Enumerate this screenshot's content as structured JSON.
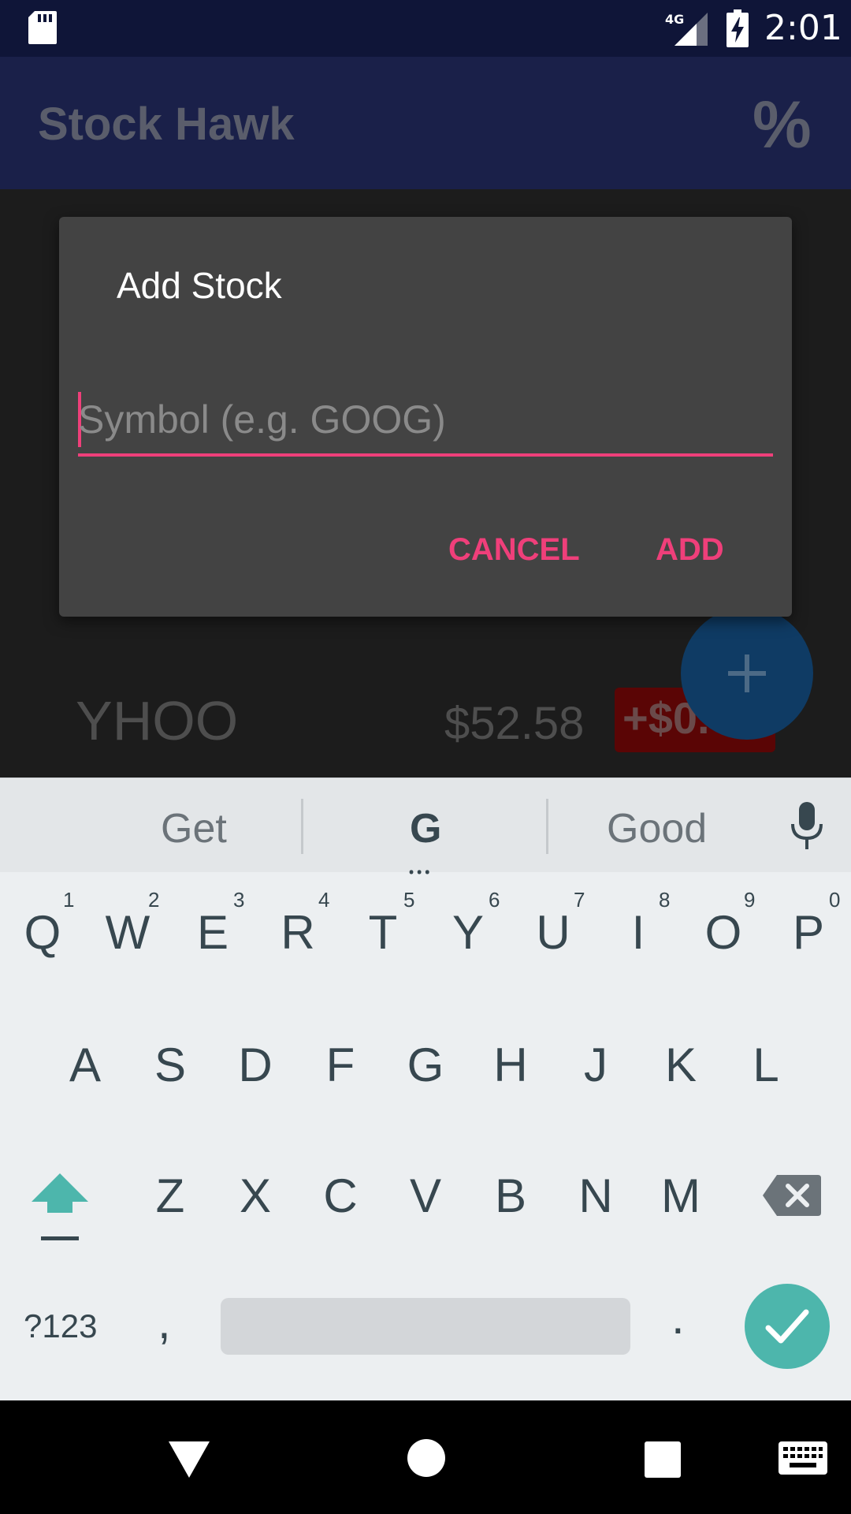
{
  "status_bar": {
    "time": "2:01",
    "network": "4G",
    "icons": [
      "sd-card-icon",
      "signal-icon",
      "battery-charging-icon"
    ]
  },
  "app_bar": {
    "title": "Stock Hawk",
    "action_label": "%"
  },
  "stock_list": [
    {
      "symbol": "YHOO",
      "price": "$52.58",
      "change": "+$0.",
      "change_color": "#5a0505"
    }
  ],
  "fab": {
    "icon": "plus-icon"
  },
  "dialog": {
    "title": "Add Stock",
    "input_placeholder": "Symbol (e.g. GOOG)",
    "input_value": "",
    "cancel_label": "CANCEL",
    "add_label": "ADD",
    "accent_color": "#ef3f7a"
  },
  "keyboard": {
    "suggestions": [
      "Get",
      "G",
      "Good"
    ],
    "row1": [
      "Q",
      "W",
      "E",
      "R",
      "T",
      "Y",
      "U",
      "I",
      "O",
      "P"
    ],
    "row1_numbers": [
      "1",
      "2",
      "3",
      "4",
      "5",
      "6",
      "7",
      "8",
      "9",
      "0"
    ],
    "row2": [
      "A",
      "S",
      "D",
      "F",
      "G",
      "H",
      "J",
      "K",
      "L"
    ],
    "row3": [
      "Z",
      "X",
      "C",
      "V",
      "B",
      "N",
      "M"
    ],
    "symbols_key": "?123",
    "comma_key": ",",
    "period_key": ".",
    "enter_color": "#4db6ac"
  },
  "nav_bar": {
    "icons": [
      "back-icon",
      "home-icon",
      "recents-icon",
      "keyboard-switch-icon"
    ]
  }
}
